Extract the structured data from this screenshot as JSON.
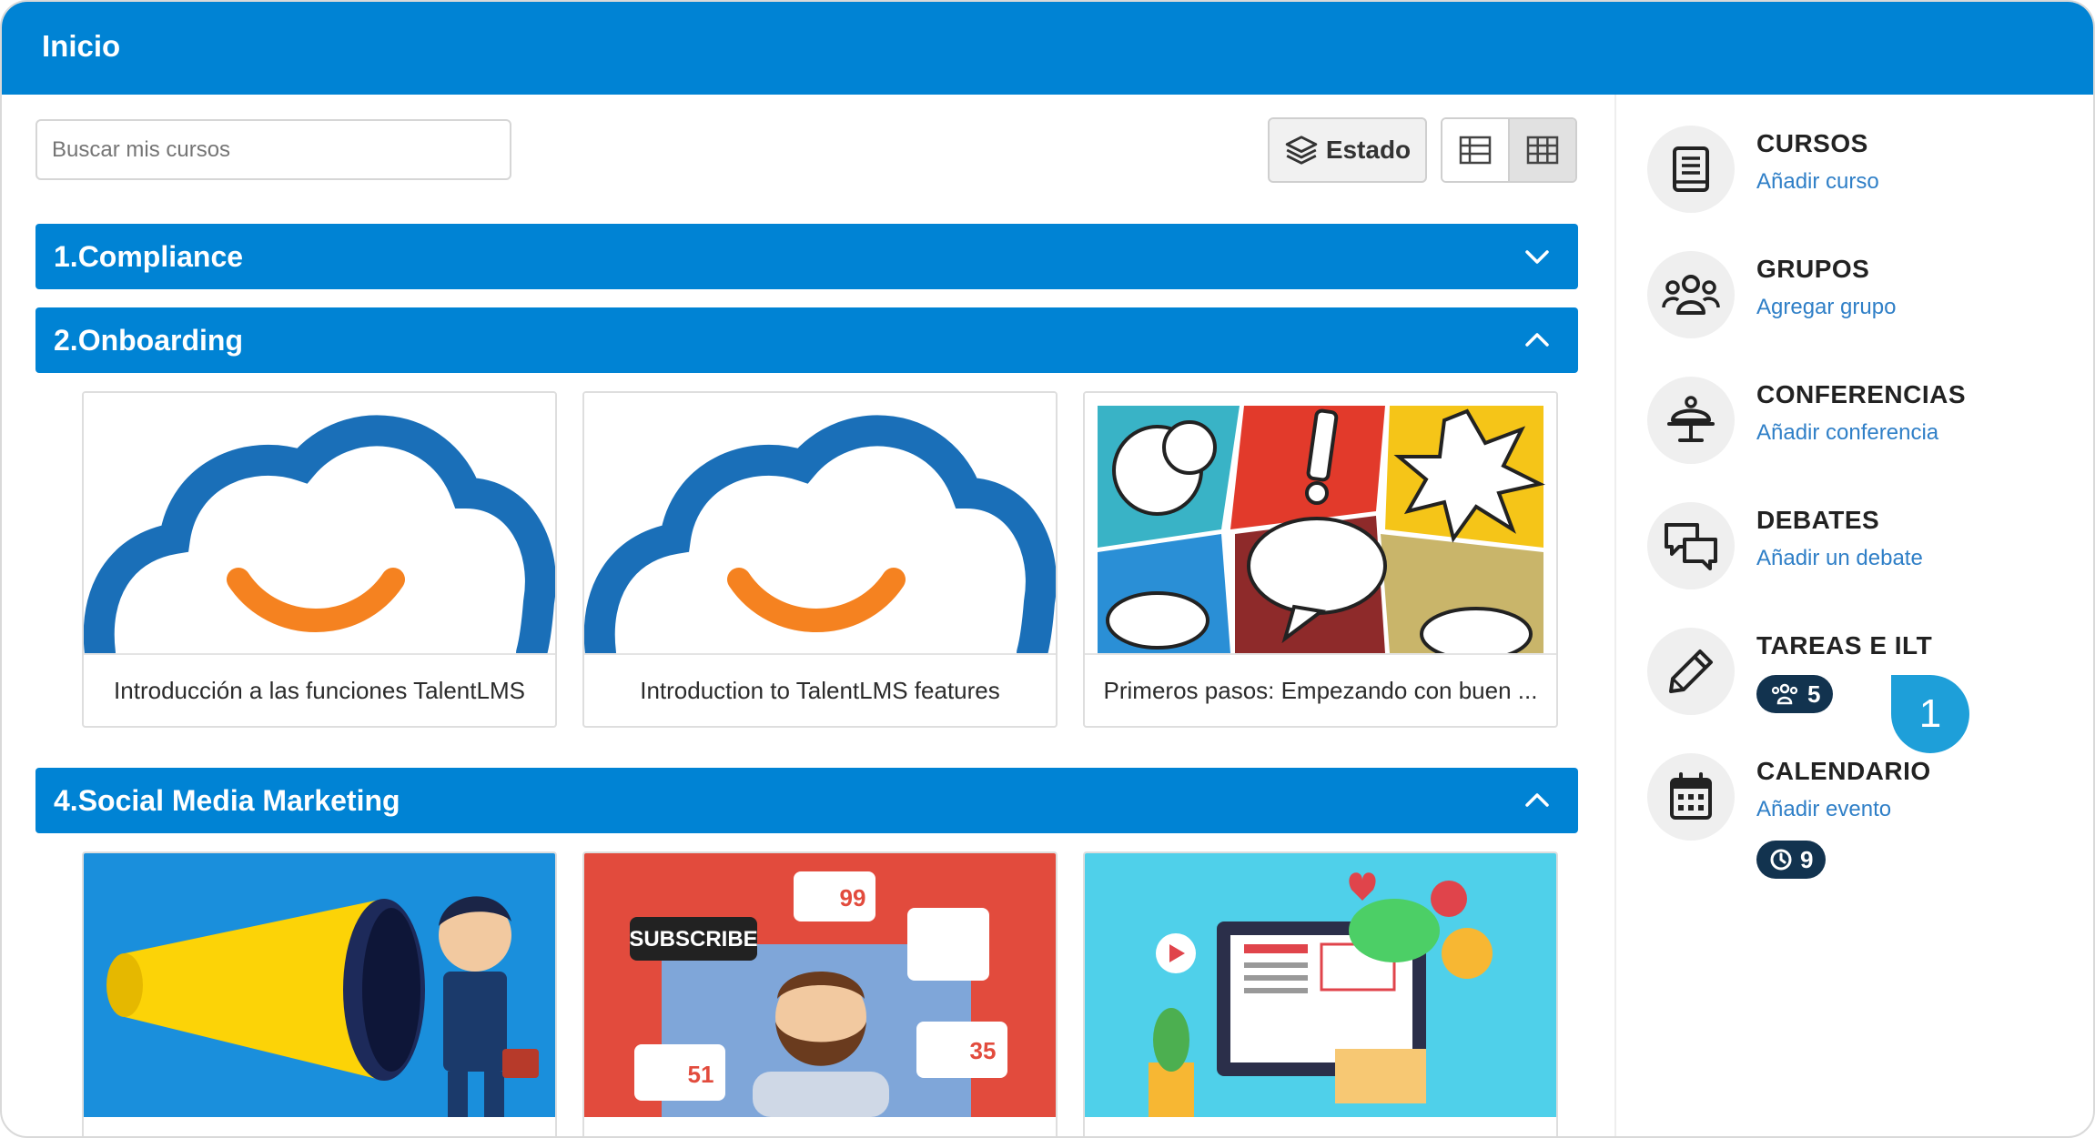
{
  "header": {
    "title": "Inicio"
  },
  "toolbar": {
    "search_placeholder": "Buscar mis cursos",
    "estado_label": "Estado"
  },
  "categories": [
    {
      "label": "1.Compliance",
      "expanded": false
    },
    {
      "label": "2.Onboarding",
      "expanded": true
    },
    {
      "label": "4.Social Media Marketing",
      "expanded": true
    }
  ],
  "onboarding_courses": [
    {
      "title": "Introducción a las funciones TalentLMS",
      "image": "talentlms-cloud-logo"
    },
    {
      "title": "Introduction to TalentLMS features",
      "image": "talentlms-cloud-logo"
    },
    {
      "title": "Primeros pasos: Empezando con buen ...",
      "image": "comic-speech-bubbles"
    }
  ],
  "social_courses": [
    {
      "image": "megaphone-businessman"
    },
    {
      "image": "social-media-subscribe",
      "badges": [
        "SUBSCRIBE",
        "99",
        "51",
        "35"
      ]
    },
    {
      "image": "social-media-laptop"
    }
  ],
  "sidebar": {
    "cursos": {
      "title": "CURSOS",
      "link": "Añadir curso",
      "icon": "book-icon"
    },
    "grupos": {
      "title": "GRUPOS",
      "link": "Agregar grupo",
      "icon": "users-icon"
    },
    "conferencias": {
      "title": "CONFERENCIAS",
      "link": "Añadir conferencia",
      "icon": "conference-icon"
    },
    "debates": {
      "title": "DEBATES",
      "link": "Añadir un debate",
      "icon": "chat-icon"
    },
    "tareas": {
      "title": "TAREAS E ILT",
      "badge_count": "5",
      "icon": "pencil-icon"
    },
    "calendario": {
      "title": "CALENDARIO",
      "link": "Añadir evento",
      "badge_count": "9",
      "icon": "calendar-icon"
    }
  },
  "callout": {
    "number": "1"
  },
  "colors": {
    "brand_blue": "#0083d4",
    "link_blue": "#2f7fc7",
    "pill_dark": "#12334f",
    "callout_blue": "#1e9fd9"
  }
}
